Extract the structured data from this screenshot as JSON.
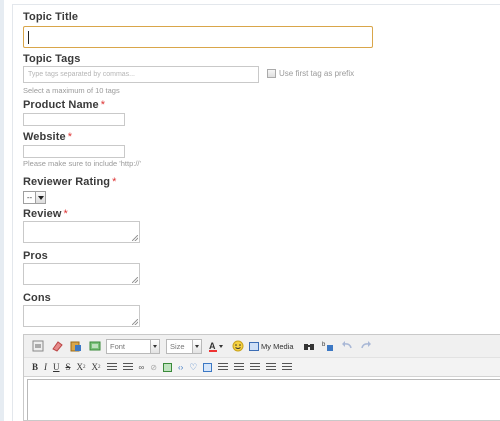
{
  "form": {
    "topic_title": {
      "label": "Topic Title",
      "value": ""
    },
    "topic_tags": {
      "label": "Topic Tags",
      "placeholder": "Type tags separated by commas...",
      "help": "Select a maximum of 10 tags",
      "prefix_label": "Use first tag as prefix",
      "prefix_checked": false
    },
    "product_name": {
      "label": "Product Name",
      "required_mark": "*",
      "value": ""
    },
    "website": {
      "label": "Website",
      "required_mark": "*",
      "value": "",
      "help": "Please make sure to include 'http://'"
    },
    "reviewer_rating": {
      "label": "Reviewer Rating",
      "required_mark": "*",
      "selected": "--"
    },
    "review": {
      "label": "Review",
      "required_mark": "*",
      "value": ""
    },
    "pros": {
      "label": "Pros",
      "value": ""
    },
    "cons": {
      "label": "Cons",
      "value": ""
    }
  },
  "editor": {
    "font_placeholder": "Font",
    "size_placeholder": "Size",
    "my_media_label": "My Media",
    "toolbar1_icons": [
      "source-icon",
      "eraser-icon",
      "paste-word-icon",
      "paste-text-icon",
      "text-color-icon",
      "emoticon-icon",
      "media-icon",
      "binoculars-icon",
      "replace-icon",
      "undo-icon",
      "redo-icon"
    ],
    "toolbar2_labels": {
      "bold": "B",
      "italic": "I",
      "underline": "U",
      "strike": "S",
      "subscript": "X",
      "superscript": "X"
    },
    "colors": {
      "accent_focus": "#d9a64a",
      "required": "#d33333",
      "link_blue": "#3c78c4"
    }
  }
}
